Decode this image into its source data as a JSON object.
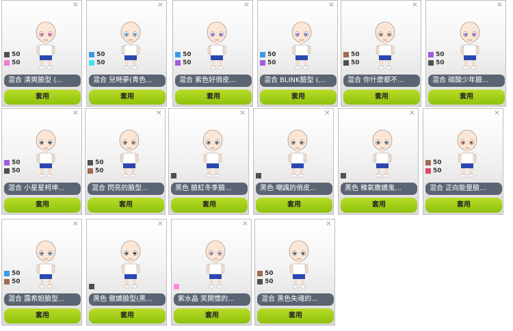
{
  "labels": {
    "apply": "套用",
    "close": "×"
  },
  "items": [
    {
      "name": "混合 清爽臉型 (...",
      "c1": "#505050",
      "v1": "50",
      "c2": "#f07ad0",
      "v2": "50",
      "eye": "#d04a8a"
    },
    {
      "name": "混合 兒時夢(青色...",
      "c1": "#3a9ae6",
      "v1": "50",
      "c2": "#44e0ee",
      "v2": "50",
      "eye": "#3a90e0"
    },
    {
      "name": "混合 紫色好俏皮...",
      "c1": "#3a9ae6",
      "v1": "50",
      "c2": "#a05ae0",
      "v2": "50",
      "eye": "#7a5ad0"
    },
    {
      "name": "混合 BLINK臉型 (...",
      "c1": "#3a9ae6",
      "v1": "50",
      "c2": "#a05ae0",
      "v2": "50",
      "eye": "#6a6ad0"
    },
    {
      "name": "混合 你什麼都不...",
      "c1": "#a06a50",
      "v1": "50",
      "c2": "#505050",
      "v2": "50",
      "eye": "#7a6a50"
    },
    {
      "name": "混合 碳酸少年臉...",
      "c1": "#a05ae0",
      "v1": "50",
      "c2": "#505050",
      "v2": "50",
      "eye": "#7a5ab0"
    },
    {
      "name": "混合 小星星柯坤...",
      "c1": "#a05ae0",
      "v1": "50",
      "c2": "#505050",
      "v2": "50",
      "eye": "#444444"
    },
    {
      "name": "混合 閃亮的臉型...",
      "c1": "#505050",
      "v1": "50",
      "c2": "#a06a50",
      "v2": "50",
      "eye": "#6a5a4a"
    },
    {
      "name": "黑色 臉紅冬季臉...",
      "c1": "#505050",
      "v1": "",
      "c2": "",
      "v2": "",
      "eye": "#555555"
    },
    {
      "name": "黑色 嘲諷的俏皮...",
      "c1": "#505050",
      "v1": "",
      "c2": "",
      "v2": "",
      "eye": "#555555"
    },
    {
      "name": "黑色 稚氣撒嬌鬼...",
      "c1": "#505050",
      "v1": "",
      "c2": "",
      "v2": "",
      "eye": "#555555"
    },
    {
      "name": "混合 正向能量臉...",
      "c1": "#a06a50",
      "v1": "50",
      "c2": "#e04a6a",
      "v2": "50",
      "eye": "#a04040"
    },
    {
      "name": "混合 露希妲臉型...",
      "c1": "#3a9ae6",
      "v1": "50",
      "c2": "#a06a50",
      "v2": "50",
      "eye": "#4a6a8a"
    },
    {
      "name": "黑色 傲嬌臉型(黑...",
      "c1": "#505050",
      "v1": "",
      "c2": "",
      "v2": "",
      "eye": "#444444"
    },
    {
      "name": "紫水晶 笑開懷的...",
      "c1": "#ff8ad8",
      "v1": "",
      "c2": "",
      "v2": "",
      "eye": "#9a6aa0"
    },
    {
      "name": "混合 黑色失魂的...",
      "c1": "#a06a50",
      "v1": "50",
      "c2": "#505050",
      "v2": "50",
      "eye": "#555555"
    }
  ]
}
